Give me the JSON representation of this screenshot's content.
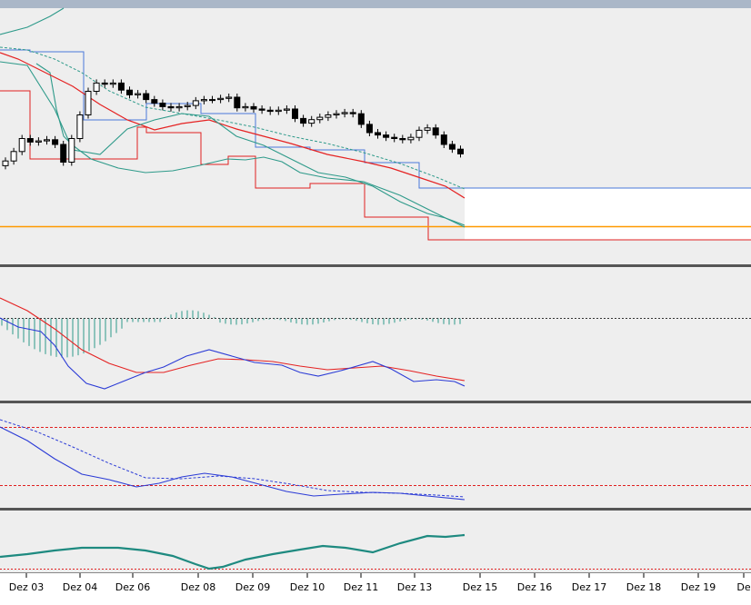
{
  "window": {
    "title_bar_color": "#aab7c8"
  },
  "colors": {
    "background": "#eeeeee",
    "candle_up": "#ffffff",
    "candle_down": "#000000",
    "red_line": "#e52222",
    "blue_line": "#2b3bd6",
    "teal_line": "#2e9a8a",
    "orange_line": "#ff9900",
    "box_blue": "#4a78d9",
    "box_red": "#e02020",
    "separator": "#555555"
  },
  "chart_data": {
    "type": "line",
    "x_ticks": [
      "Dez 03",
      "Dez 04",
      "Dez 06",
      "Dez 08",
      "Dez 09",
      "Dez 10",
      "Dez 11",
      "Dez 13",
      "Dez 15",
      "Dez 16",
      "Dez 17",
      "Dez 18",
      "Dez 19",
      "De"
    ],
    "candles": [
      {
        "o": 0.02,
        "c": 0.06
      },
      {
        "o": 0.06,
        "c": 0.14
      },
      {
        "o": 0.14,
        "c": 0.25
      },
      {
        "o": 0.25,
        "c": 0.22
      },
      {
        "o": 0.22,
        "c": 0.23
      },
      {
        "o": 0.23,
        "c": 0.24
      },
      {
        "o": 0.24,
        "c": 0.2
      },
      {
        "o": 0.2,
        "c": 0.05
      },
      {
        "o": 0.05,
        "c": 0.25
      },
      {
        "o": 0.25,
        "c": 0.45
      },
      {
        "o": 0.45,
        "c": 0.65
      },
      {
        "o": 0.65,
        "c": 0.72
      },
      {
        "o": 0.72,
        "c": 0.71
      },
      {
        "o": 0.71,
        "c": 0.72
      },
      {
        "o": 0.72,
        "c": 0.66
      },
      {
        "o": 0.66,
        "c": 0.62
      },
      {
        "o": 0.62,
        "c": 0.63
      },
      {
        "o": 0.63,
        "c": 0.58
      },
      {
        "o": 0.58,
        "c": 0.55
      },
      {
        "o": 0.55,
        "c": 0.52
      },
      {
        "o": 0.52,
        "c": 0.51
      },
      {
        "o": 0.51,
        "c": 0.52
      },
      {
        "o": 0.52,
        "c": 0.53
      },
      {
        "o": 0.53,
        "c": 0.57
      },
      {
        "o": 0.57,
        "c": 0.58
      },
      {
        "o": 0.58,
        "c": 0.58
      },
      {
        "o": 0.58,
        "c": 0.59
      },
      {
        "o": 0.59,
        "c": 0.6
      },
      {
        "o": 0.6,
        "c": 0.51
      },
      {
        "o": 0.51,
        "c": 0.52
      },
      {
        "o": 0.52,
        "c": 0.5
      },
      {
        "o": 0.5,
        "c": 0.49
      },
      {
        "o": 0.49,
        "c": 0.48
      },
      {
        "o": 0.48,
        "c": 0.49
      },
      {
        "o": 0.49,
        "c": 0.5
      },
      {
        "o": 0.5,
        "c": 0.42
      },
      {
        "o": 0.42,
        "c": 0.38
      },
      {
        "o": 0.38,
        "c": 0.41
      },
      {
        "o": 0.41,
        "c": 0.43
      },
      {
        "o": 0.43,
        "c": 0.45
      },
      {
        "o": 0.45,
        "c": 0.46
      },
      {
        "o": 0.46,
        "c": 0.47
      },
      {
        "o": 0.47,
        "c": 0.46
      },
      {
        "o": 0.46,
        "c": 0.37
      },
      {
        "o": 0.37,
        "c": 0.3
      },
      {
        "o": 0.3,
        "c": 0.28
      },
      {
        "o": 0.28,
        "c": 0.26
      },
      {
        "o": 0.26,
        "c": 0.25
      },
      {
        "o": 0.25,
        "c": 0.24
      },
      {
        "o": 0.24,
        "c": 0.26
      },
      {
        "o": 0.26,
        "c": 0.32
      },
      {
        "o": 0.32,
        "c": 0.34
      },
      {
        "o": 0.34,
        "c": 0.28
      },
      {
        "o": 0.28,
        "c": 0.2
      },
      {
        "o": 0.2,
        "c": 0.16
      },
      {
        "o": 0.16,
        "c": 0.12
      }
    ],
    "panes": [
      {
        "name": "price",
        "series": [
          "upper-band",
          "lower-band",
          "red-ma",
          "teal-dashed",
          "teal-solid",
          "orange-level"
        ]
      },
      {
        "name": "macd",
        "series": [
          "macd-histogram",
          "macd-blue",
          "macd-red",
          "zero-line"
        ]
      },
      {
        "name": "stochastic",
        "series": [
          "stoch-blue",
          "stoch-dashed",
          "level-high",
          "level-low"
        ]
      },
      {
        "name": "indicator",
        "series": [
          "teal-indicator",
          "level-low"
        ]
      }
    ]
  }
}
